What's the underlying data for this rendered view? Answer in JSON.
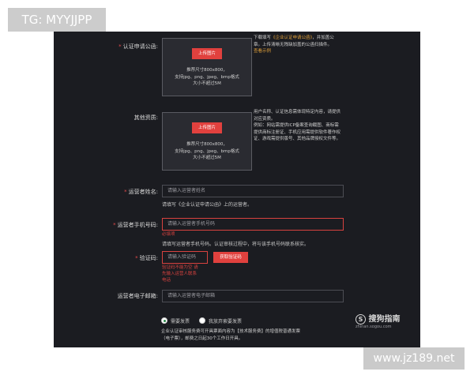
{
  "overlays": {
    "top_left_tag": "TG: MYYJJPP",
    "bottom_right_tag": "www.jz189.net"
  },
  "form": {
    "required_mark": "*",
    "certificate": {
      "label": "认证申请公函:",
      "upload_button": "上传图片",
      "upload_hint_lines": [
        "推荐尺寸800x800，",
        "支持jpg、png、jpeg、bmp格式",
        "大小不超过5M"
      ],
      "note_lines": [
        "下载填写《企业认证申请公函》，并加盖公",
        "章。上传清晰无残缺加盖的公函扫描件。"
      ],
      "note_link_inline": "《企业认证申请公函》",
      "note_view_example": "查看示例"
    },
    "other": {
      "label": "其他资质:",
      "upload_button": "上传图片",
      "upload_hint_lines": [
        "推荐尺寸800x800，",
        "支持jpg、png、jpeg、bmp格式",
        "大小不超过5M"
      ],
      "note_lines": [
        "用户名称、认证信息需体现特定内容，请提供",
        "对应资质。",
        "例如：网站需提供ICP备案查询截图、商标需",
        "提供商标注册证、手机应用需提供软件著作权",
        "证、游戏需提供版号、其他品牌授权文件等。"
      ]
    },
    "operator_name": {
      "label": "运营者姓名:",
      "placeholder": "请输入运营者姓名",
      "hint": "请填写《企业认证申请公函》上的运营者。"
    },
    "operator_phone": {
      "label": "运营者手机号码:",
      "placeholder": "请输入运营者手机号码",
      "error": "必填项",
      "hint": "请填写运营者手机号码。认证审核过程中，将与该手机号码联系核实。"
    },
    "verify_code": {
      "label": "验证码:",
      "placeholder": "请输入验证码",
      "button": "获取验证码",
      "error_lines": [
        "验证码不能为空 请",
        "先输入运营人联系",
        "电话"
      ]
    },
    "operator_email": {
      "label": "运营者电子邮箱:",
      "placeholder": "请输入运营者电子邮箱"
    },
    "invoice": {
      "option_need": "需要发票",
      "option_skip": "我放弃索要发票",
      "selected": "需要发票",
      "note_lines": [
        "企业认证审核服务费可开具票面内容为【技术服务费】的增值税普通发票",
        "（电子票），邮费之日起30个工作日开具。"
      ]
    }
  },
  "brand": {
    "logo_text": "搜狗指南",
    "url": "zhinan.sogou.com"
  },
  "colors": {
    "panel_bg": "#1b1c21",
    "accent_red": "#e1413e",
    "link_orange": "#e0a03a",
    "radio_green": "#2b8a4a"
  }
}
